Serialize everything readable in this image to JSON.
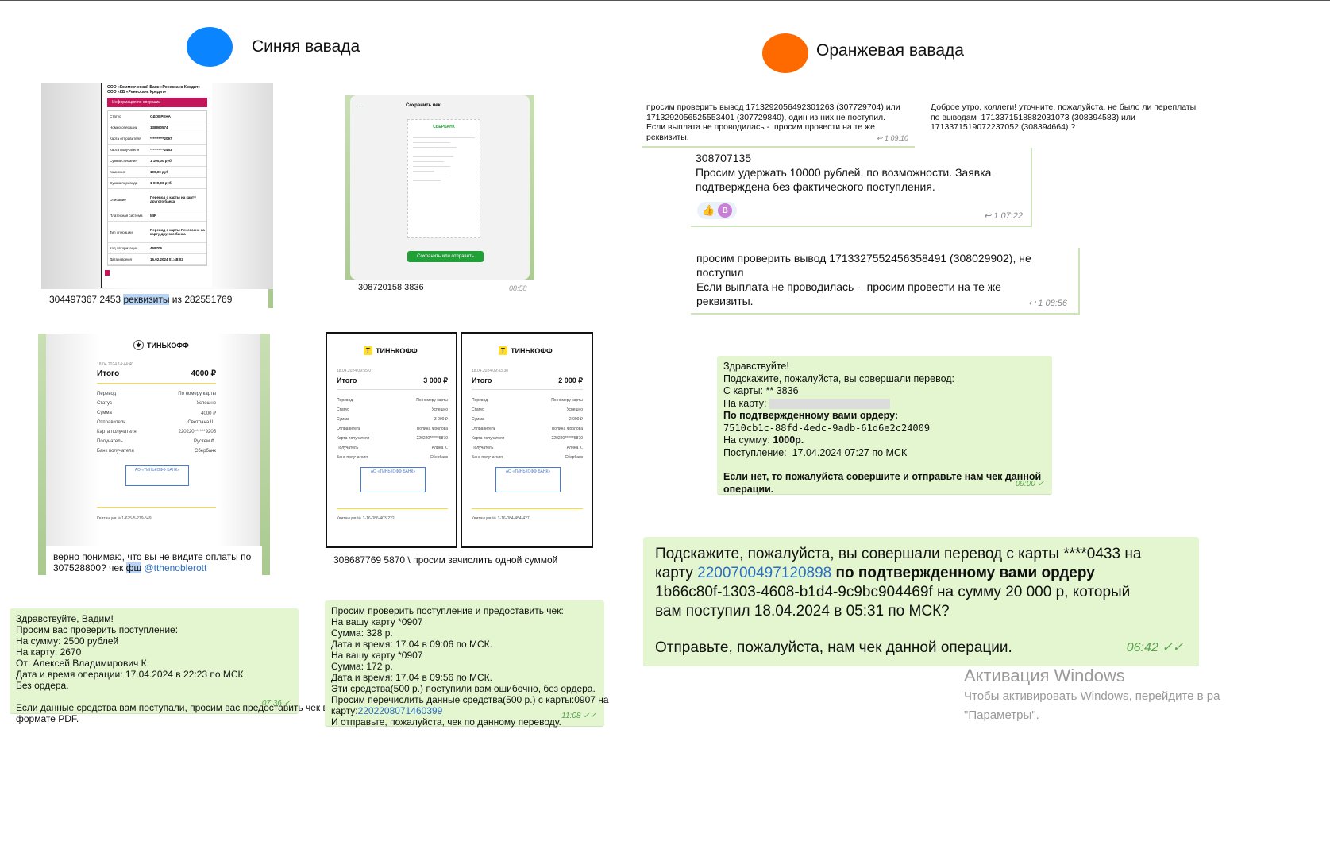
{
  "headers": {
    "blue": {
      "label": "Синяя вавада",
      "color": "#0a84ff"
    },
    "orange": {
      "label": "Оранжевая вавада",
      "color": "#ff6a00"
    }
  },
  "receipt1": {
    "bank_line1": "ООО «Коммерческий Банк «Ренессанс Кредит»",
    "bank_line2": "ООО «КБ «Ренессанс Кредит»",
    "section": "Информация по операции",
    "rows": [
      [
        "Статус",
        "ОДОБРЕНА"
      ],
      [
        "Номер операции",
        "138860574"
      ],
      [
        "Карта отправителя",
        "**********2097"
      ],
      [
        "Карта получателя",
        "**********2453"
      ],
      [
        "Сумма списания",
        "1 100,00 руб"
      ],
      [
        "Комиссия",
        "100,00 руб"
      ],
      [
        "Сумма перевода",
        "1 000,00 руб"
      ],
      [
        "Описание",
        "Перевод с карты на карту другого банка"
      ],
      [
        "Платежная система",
        "MIR"
      ],
      [
        "Тип операции",
        "Перевод с карты Ренессанс на карту другого банка"
      ],
      [
        "Код авторизации",
        "468706"
      ],
      [
        "Дата и время",
        "16.02.2024 01:48:02"
      ]
    ],
    "caption_pre": "304497367 2453 ",
    "caption_hl": "реквизиты",
    "caption_post": " из 282551769"
  },
  "receipt2": {
    "title": "Сохранить чек",
    "bank": "СБЕРБАНК",
    "button": "Сохранить или отправить",
    "caption": "308720158 3836",
    "time": "08:58"
  },
  "receipt3": {
    "brand": "ТИНЬКОФФ",
    "date": "18.04.2024 14:44:40",
    "total_label": "Итого",
    "total": "4000 ₽",
    "rows": [
      [
        "Перевод",
        "По номеру карты"
      ],
      [
        "Статус",
        "Успешно"
      ],
      [
        "Сумма",
        "4000 ₽"
      ],
      [
        "Отправитель",
        "Светлана Ш."
      ],
      [
        "Карта получателя",
        "220220******9205"
      ],
      [
        "Получатель",
        "Рустем Ф."
      ],
      [
        "Банк получателя",
        "Сбербанк"
      ]
    ],
    "receipt_no": "Квитанция №1-675-5-279-549",
    "caption_line1": "верно понимаю, что вы не видите оплаты по",
    "caption_line2_pre": "307528800? чек ",
    "caption_hl": "фш",
    "caption_link": " @tthenoblerott"
  },
  "receipt4": {
    "brand": "ТИНЬКОФФ",
    "left": {
      "date": "18.04.2024 09:55:07",
      "total": "3 000 ₽",
      "rows": [
        [
          "Перевод",
          "По номеру карты"
        ],
        [
          "Статус",
          "Успешно"
        ],
        [
          "Сумма",
          "3 000 ₽"
        ],
        [
          "Отправитель",
          "Полина Фролова"
        ],
        [
          "Карта получателя",
          "220220******5870"
        ],
        [
          "Получатель",
          "Алина К."
        ],
        [
          "Банк получателя",
          "Сбербанк"
        ]
      ],
      "receipt_no": "Квитанция № 1-16-086-403-222"
    },
    "right": {
      "date": "18.04.2024 09:33:38",
      "total": "2 000 ₽",
      "rows": [
        [
          "Перевод",
          "По номеру карты"
        ],
        [
          "Статус",
          "Успешно"
        ],
        [
          "Сумма",
          "2 000 ₽"
        ],
        [
          "Отправитель",
          "Полина Фролова"
        ],
        [
          "Карта получателя",
          "220220******5870"
        ],
        [
          "Получатель",
          "Алина К."
        ],
        [
          "Банк получателя",
          "Сбербанк"
        ]
      ],
      "receipt_no": "Квитанция № 1-16-084-454-427"
    },
    "total_label": "Итого",
    "caption": "308687769 5870 \\ просим зачислить одной суммой"
  },
  "bubble_blue1": {
    "lines": [
      "Здравствуйте, Вадим!",
      "Просим вас проверить поступление:",
      "На сумму: 2500 рублей",
      "На карту: 2670",
      "От: Алексей Владимирович К.",
      "Дата и время операции: 17.04.2024 в 22:23 по МСК",
      "Без ордера.",
      "",
      "Если данные средства вам поступали, просим вас предоставить чек в",
      "формате PDF."
    ],
    "time": "07:36 ✓"
  },
  "bubble_blue2": {
    "lines": [
      "Просим проверить поступление и предоставить чек:",
      "На вашу карту *0907",
      "Сумма: 328 р.",
      "Дата и время: 17.04 в 09:06 по МСК.",
      "На вашу карту *0907",
      "Сумма: 172 р.",
      "Дата и время: 17.04 в 09:56 по МСК.",
      "Эти средства(500 р.) поступили вам ошибочно, без ордера.",
      "Просим перечислить данные средства(500 р.) с карты:0907 на"
    ],
    "line_card_pre": "карту:",
    "line_card_link": "2202208071460399",
    "line_last": "И отправьте, пожалуйста, чек по данному переводу.",
    "time": "11:08 ✓✓"
  },
  "orange_chat": {
    "msg1": "просим проверить вывод 1713292056492301263 (307729704) или\n1713292056525553401 (307729840), один из них не поступил.\nЕсли выплата не проводилась -  просим провести на те же\nреквизиты.",
    "msg1_time": "1 09:10",
    "msg2": "Доброе утро, коллеги! уточните, пожалуйста, не было ли переплаты\nпо выводам  1713371518882031073 (308394583) или\n1713371519072237052 (308394664) ?",
    "msg3_id": "308707135",
    "msg3_text": "Просим удержать 10000 рублей, по возможности. Заявка\nподтверждена без фактического поступления.",
    "react_thumb": "👍",
    "react_letter": "B",
    "msg3_time": "1 07:22",
    "msg4": "просим проверить вывод 1713327552456358491 (308029902), не\nпоступил\nЕсли выплата не проводилась -  просим провести на те же\nреквизиты.",
    "msg4_time": "1 08:56"
  },
  "bubble_orange1": {
    "l1": "Здравствуйте!",
    "l2": "Подскажите, пожалуйста, вы совершали перевод:",
    "l3": "С карты: ** 3836",
    "l4": "На карту:",
    "l5": "По подтвержденному вами ордеру:",
    "l6": "7510cb1c-88fd-4edc-9adb-61d6e2c24009",
    "l7_pre": "На сумму: ",
    "l7_bold": "1000р.",
    "l8": "Поступление:  17.04.2024 07:27 по МСК",
    "l9": "Если нет, то пожалуйста совершите и отправьте нам чек данной",
    "l10": "операции.",
    "time": "09:00 ✓"
  },
  "bubble_orange2": {
    "l1": "Подскажите, пожалуйста, вы совершали перевод с карты ****0433 на",
    "l2_pre": "карту ",
    "l2_link": "2200700497120898",
    "l2_bold": " по подтвержденному вами ордеру",
    "l3": "1b66c80f-1303-4608-b1d4-9c9bc904469f на сумму 20 000 р, который",
    "l4": "вам поступил 18.04.2024 в 05:31 по МСК?",
    "l5": "Отправьте, пожалуйста, нам чек данной операции.",
    "time": "06:42 ✓✓"
  },
  "watermark": {
    "title": "Активация Windows",
    "line1": "Чтобы активировать Windows, перейдите в ра",
    "line2": "\"Параметры\"."
  }
}
